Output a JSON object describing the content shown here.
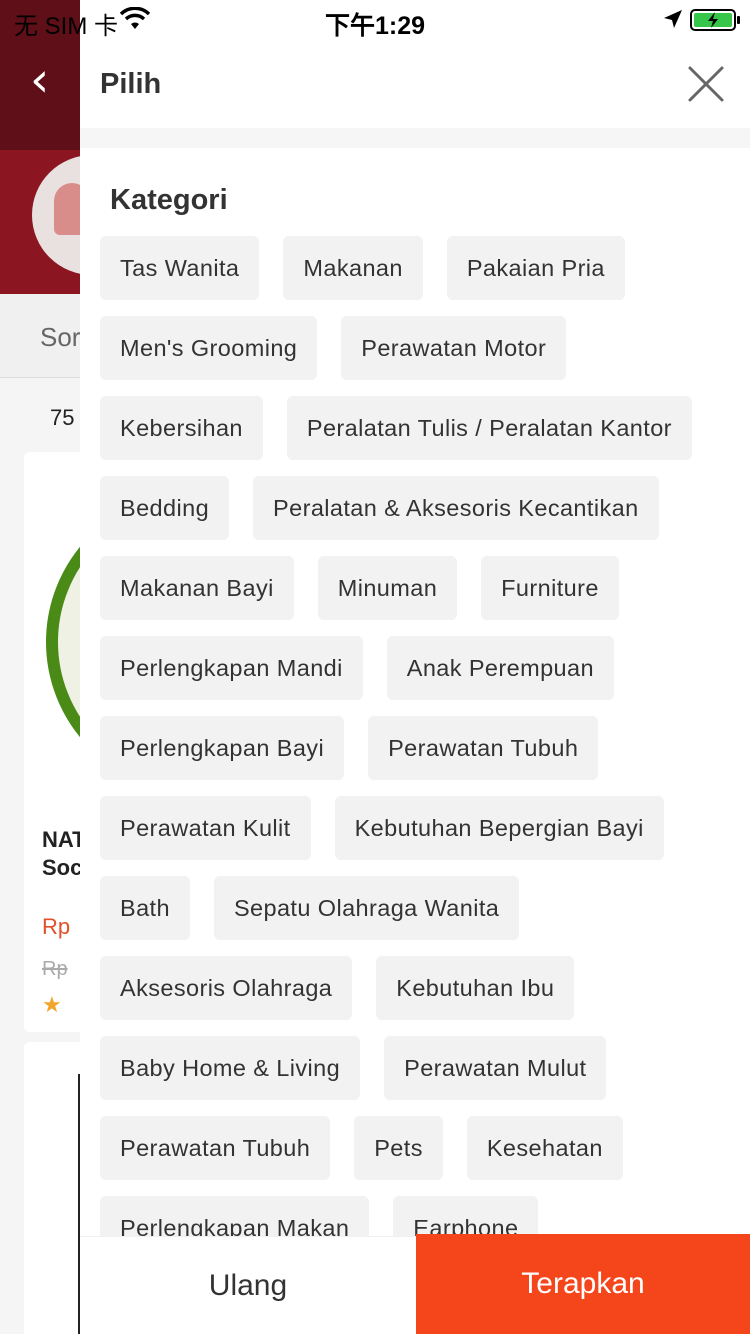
{
  "status_bar": {
    "carrier": "无 SIM 卡",
    "time": "下午1:29"
  },
  "background": {
    "sort_label": "Sor",
    "count": "75",
    "card_title_line1": "NAT",
    "card_title_line2": "Soc",
    "card_price": "Rp",
    "card_old_price": "Rp"
  },
  "panel": {
    "title": "Pilih",
    "section_title": "Kategori",
    "categories": [
      "Tas Wanita",
      "Makanan",
      "Pakaian Pria",
      "Men's Grooming",
      "Perawatan Motor",
      "Kebersihan",
      "Peralatan Tulis / Peralatan Kantor",
      "Bedding",
      "Peralatan & Aksesoris Kecantikan",
      "Makanan Bayi",
      "Minuman",
      "Furniture",
      "Perlengkapan Mandi",
      "Anak Perempuan",
      "Perlengkapan Bayi",
      "Perawatan Tubuh",
      "Perawatan Kulit",
      "Kebutuhan Bepergian Bayi",
      "Bath",
      "Sepatu Olahraga Wanita",
      "Aksesoris Olahraga",
      "Kebutuhan Ibu",
      "Baby Home & Living",
      "Perawatan Mulut",
      "Perawatan Tubuh",
      "Pets",
      "Kesehatan",
      "Perlengkapan Makan",
      "Earphone"
    ],
    "reset_label": "Ulang",
    "apply_label": "Terapkan"
  },
  "colors": {
    "accent": "#f5451b",
    "chip_bg": "#f2f2f2",
    "header_bg": "#8b1622"
  }
}
